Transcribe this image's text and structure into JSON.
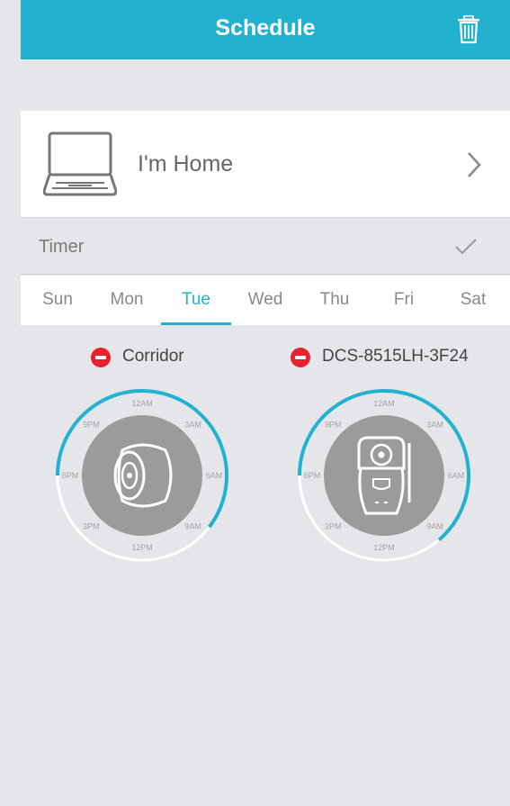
{
  "header": {
    "title": "Schedule",
    "trash_icon": "trash-icon"
  },
  "profile": {
    "label": "I'm Home",
    "icon": "laptop-icon",
    "chevron": "chevron-right-icon"
  },
  "timer": {
    "label": "Timer",
    "icon": "checkmark-icon"
  },
  "days": {
    "items": [
      "Sun",
      "Mon",
      "Tue",
      "Wed",
      "Thu",
      "Fri",
      "Sat"
    ],
    "selected": "Tue"
  },
  "clock_labels": [
    "12AM",
    "3AM",
    "6AM",
    "9AM",
    "12PM",
    "3PM",
    "6PM",
    "9PM"
  ],
  "devices": [
    {
      "name": "Corridor",
      "camera_icon": "round-camera-icon",
      "schedule_start_hour": 18,
      "schedule_end_hour": 8.5
    },
    {
      "name": "DCS-8515LH-3F24",
      "camera_icon": "pan-tilt-camera-icon",
      "schedule_start_hour": 18,
      "schedule_end_hour": 9.3
    }
  ],
  "colors": {
    "accent": "#22b1cf",
    "remove": "#e8212e",
    "dial_face": "#9b9b9b",
    "ring": "#ffffff"
  }
}
